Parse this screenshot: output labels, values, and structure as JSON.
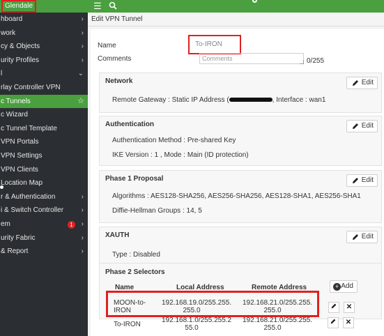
{
  "sidebar": {
    "device": "Glendale",
    "items": [
      {
        "label": "hboard",
        "chevron": true
      },
      {
        "label": "work",
        "chevron": true
      },
      {
        "label": "cy & Objects",
        "chevron": true
      },
      {
        "label": "urity Profiles",
        "chevron": true
      },
      {
        "label": "l",
        "chevron": true,
        "expanded": true
      },
      {
        "label": "rlay Controller VPN",
        "chevron": false
      },
      {
        "label": "c Tunnels",
        "chevron": false,
        "active": true,
        "favorite": true
      },
      {
        "label": "c Wizard",
        "chevron": false
      },
      {
        "label": "c Tunnel Template",
        "chevron": false
      },
      {
        "label": "VPN Portals",
        "chevron": false
      },
      {
        "label": "VPN Settings",
        "chevron": false
      },
      {
        "label": "VPN Clients",
        "chevron": false
      },
      {
        "label": "Location Map",
        "chevron": false
      },
      {
        "label": "r & Authentication",
        "chevron": true
      },
      {
        "label": "i & Switch Controller",
        "chevron": true
      },
      {
        "label": "em",
        "chevron": true,
        "badge": "1"
      },
      {
        "label": "urity Fabric",
        "chevron": true
      },
      {
        "label": "& Report",
        "chevron": true
      }
    ]
  },
  "topbar": {
    "menu_icon": "☰"
  },
  "page": {
    "title": "Edit VPN Tunnel"
  },
  "form": {
    "name_label": "Name",
    "name_value": "To-IRON",
    "comments_label": "Comments",
    "comments_placeholder": "Comments",
    "comments_counter": "0/255"
  },
  "sections": {
    "network": {
      "title": "Network",
      "edit": "Edit",
      "line_prefix": "Remote Gateway : Static IP Address (",
      "line_suffix": ", Interface : wan1"
    },
    "authentication": {
      "title": "Authentication",
      "edit": "Edit",
      "method": "Authentication Method : Pre-shared Key",
      "ike": "IKE Version : 1 , Mode : Main (ID protection)"
    },
    "phase1": {
      "title": "Phase 1 Proposal",
      "edit": "Edit",
      "algorithms": "Algorithms : AES128-SHA256, AES256-SHA256, AES128-SHA1, AES256-SHA1",
      "dh": "Diffie-Hellman Groups : 14, 5"
    },
    "xauth": {
      "title": "XAUTH",
      "edit": "Edit",
      "type": "Type : Disabled"
    }
  },
  "phase2": {
    "title": "Phase 2 Selectors",
    "col_name": "Name",
    "col_local": "Local Address",
    "col_remote": "Remote Address",
    "add": "Add",
    "rows": [
      {
        "name_1": "MOON-to-",
        "name_2": "IRON",
        "local_1": "192.168.19.0/255.255.",
        "local_2": "255.0",
        "remote_1": "192.168.21.0/255.255.",
        "remote_2": "255.0"
      },
      {
        "name_1": "To-IRON",
        "name_2": "",
        "local_1": "192.168.1.0/255.255.2",
        "local_2": "55.0",
        "remote_1": "192.168.21.0/255.255.",
        "remote_2": "255.0"
      }
    ]
  },
  "colors": {
    "accent": "#4a9f3e",
    "highlight": "#e02020",
    "sidebar": "#2b2f33"
  }
}
